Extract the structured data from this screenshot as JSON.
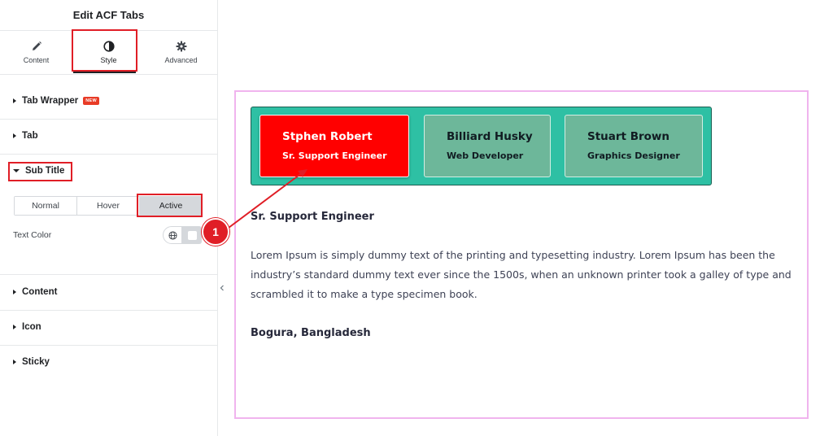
{
  "panel": {
    "title": "Edit ACF Tabs",
    "tabs": [
      {
        "label": "Content",
        "icon": "pencil-icon"
      },
      {
        "label": "Style",
        "icon": "half-circle-icon",
        "active": true
      },
      {
        "label": "Advanced",
        "icon": "gear-icon"
      }
    ],
    "sections": {
      "tab_wrapper": {
        "label": "Tab Wrapper",
        "badge": "NEW"
      },
      "tab": {
        "label": "Tab"
      },
      "sub_title": {
        "label": "Sub Title",
        "expanded": true
      },
      "content": {
        "label": "Content"
      },
      "icon": {
        "label": "Icon"
      },
      "sticky": {
        "label": "Sticky"
      }
    },
    "state_tabs": [
      "Normal",
      "Hover",
      "Active"
    ],
    "active_state": "Active",
    "text_color_label": "Text Color",
    "highlight_color": "#e01e26"
  },
  "preview": {
    "tabs": [
      {
        "name": "Stphen Robert",
        "subtitle": "Sr. Support Engineer",
        "active": true,
        "bg": "#ff0000"
      },
      {
        "name": "Billiard Husky",
        "subtitle": "Web Developer",
        "active": false,
        "bg": "#6db79a"
      },
      {
        "name": "Stuart Brown",
        "subtitle": "Graphics Designer",
        "active": false,
        "bg": "#6db79a"
      }
    ],
    "tab_bar_bg": "#2ec0a4",
    "content_title": "Sr. Support Engineer",
    "content_body": "Lorem Ipsum is simply dummy text of the printing and typesetting industry. Lorem Ipsum has been the industry’s standard dummy text ever since the 1500s, when an unknown printer took a galley of type and scrambled it to make a type specimen book.",
    "location": "Bogura, Bangladesh"
  },
  "callout": {
    "number": "1"
  }
}
